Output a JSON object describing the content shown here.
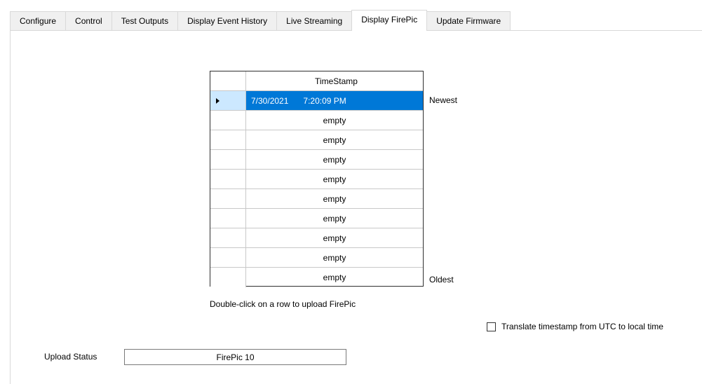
{
  "tabs": [
    {
      "label": "Configure"
    },
    {
      "label": "Control"
    },
    {
      "label": "Test Outputs"
    },
    {
      "label": "Display Event History"
    },
    {
      "label": "Live Streaming"
    },
    {
      "label": "Display FirePic",
      "active": true
    },
    {
      "label": "Update Firmware"
    }
  ],
  "grid": {
    "column_header": "TimeStamp",
    "rows": [
      {
        "date": "7/30/2021",
        "time": "7:20:09 PM",
        "selected": true
      },
      {
        "value": "empty"
      },
      {
        "value": "empty"
      },
      {
        "value": "empty"
      },
      {
        "value": "empty"
      },
      {
        "value": "empty"
      },
      {
        "value": "empty"
      },
      {
        "value": "empty"
      },
      {
        "value": "empty"
      },
      {
        "value": "empty"
      }
    ],
    "newest_label": "Newest",
    "oldest_label": "Oldest"
  },
  "hint_text": "Double-click on a row to upload FirePic",
  "translate_checkbox": {
    "label": "Translate timestamp from UTC to local time",
    "checked": false
  },
  "upload_status": {
    "label": "Upload Status",
    "value": "FirePic 10"
  },
  "colors": {
    "selection": "#0078d7",
    "row_header_selected": "#cce8ff"
  }
}
